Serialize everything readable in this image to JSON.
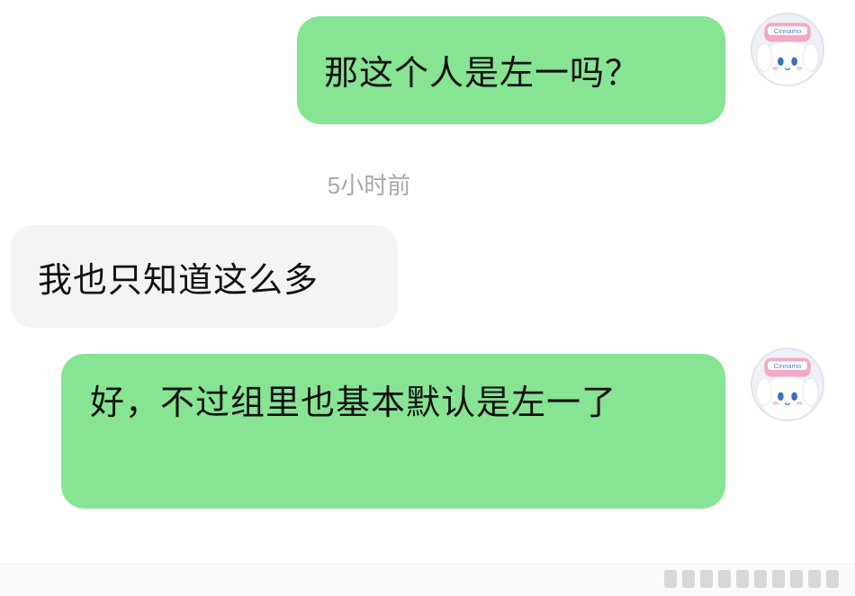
{
  "messages": [
    {
      "direction": "outgoing",
      "text": "那这个人是左一吗？"
    },
    {
      "direction": "incoming",
      "text": "我也只知道这么多"
    },
    {
      "direction": "outgoing",
      "text": "好，不过组里也基本默认是左一了"
    }
  ],
  "timestamp": "5小时前",
  "avatar": {
    "icon": "cinnamoroll-avatar-icon",
    "hat_text": "Cinnamo"
  },
  "colors": {
    "outgoing_bubble": "#86e493",
    "incoming_bubble": "#f4f4f4",
    "timestamp_text": "#a8a8a8",
    "background": "#ffffff"
  }
}
